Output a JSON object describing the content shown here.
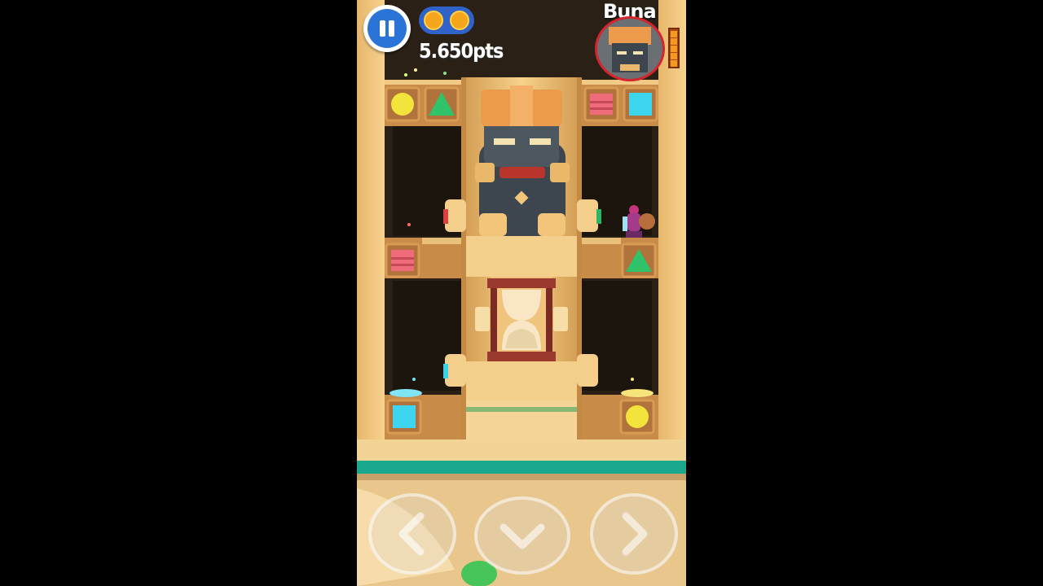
{
  "hud": {
    "score": "5.650pts",
    "coins": 2,
    "boss_name": "Buna",
    "boss_health_segments": 5
  },
  "colors": {
    "pause_blue": "#2a74d8",
    "coin_gold": "#f5a61d",
    "boss_ring": "#d6242a",
    "sand": "#f0c77f",
    "tile_yellow": "#f3e33d",
    "tile_green": "#2fc36a",
    "tile_red": "#ef6b7a",
    "tile_cyan": "#3dd6ee",
    "floor_teal": "#1aa88f"
  },
  "icons": [
    "pause-icon",
    "coin-icon",
    "left-arrow-icon",
    "down-arrow-icon",
    "right-arrow-icon",
    "hourglass-icon"
  ]
}
